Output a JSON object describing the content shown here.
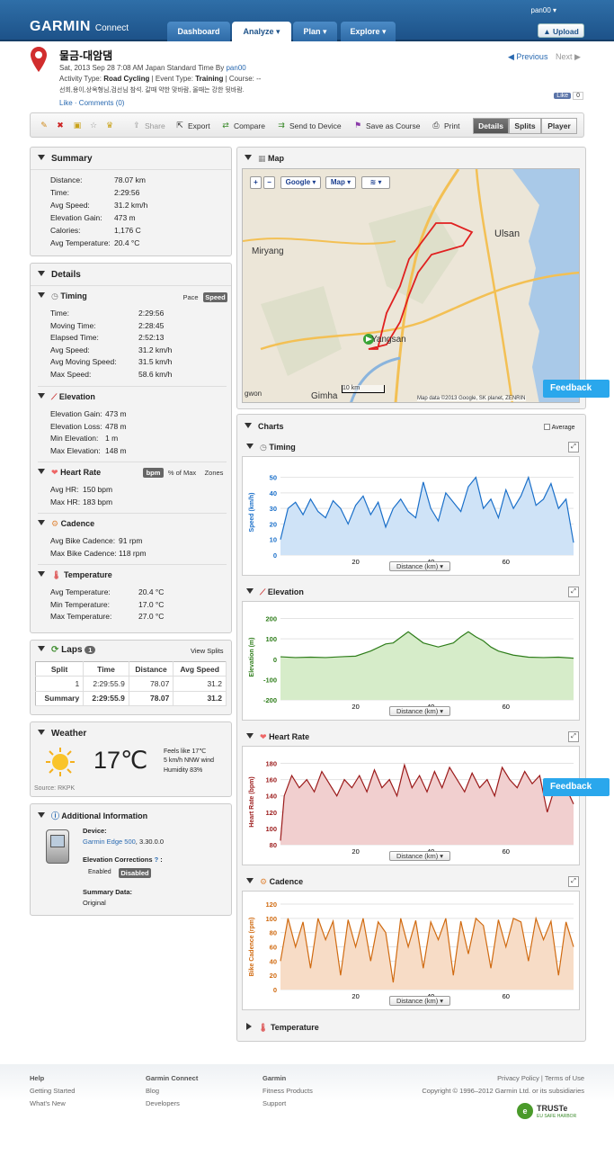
{
  "header": {
    "logo": "GARMIN",
    "logo_sub": "Connect",
    "user": "pan00 ▾",
    "upload": "Upload",
    "nav": [
      "Dashboard",
      "Analyze ▾",
      "Plan ▾",
      "Explore ▾"
    ]
  },
  "activity": {
    "title": "물금-대암댐",
    "date_line": "Sat, 2013 Sep 28 7:08 AM Japan Standard Time By",
    "by": "pan00",
    "type_label": "Activity Type:",
    "type": "Road Cycling",
    "event_label": "| Event Type:",
    "event": "Training",
    "course": "| Course: --",
    "desc": "선회,용이,상옥형님,검선님 참석. 갈때 약한 맞바람, 올때는 강한 뒷바람.",
    "like": "Like",
    "comments": "Comments (0)",
    "prev": "Previous",
    "next": "Next",
    "fb_like": "Like",
    "fb_count": "0"
  },
  "toolbar": {
    "share": "Share",
    "export": "Export",
    "compare": "Compare",
    "send": "Send to Device",
    "save_course": "Save as Course",
    "print": "Print",
    "views": [
      "Details",
      "Splits",
      "Player"
    ]
  },
  "summary": {
    "title": "Summary",
    "rows": [
      [
        "Distance:",
        "78.07 km"
      ],
      [
        "Time:",
        "2:29:56"
      ],
      [
        "Avg Speed:",
        "31.2 km/h"
      ],
      [
        "Elevation Gain:",
        "473 m"
      ],
      [
        "Calories:",
        "1,176 C"
      ],
      [
        "Avg Temperature:",
        "20.4 °C"
      ]
    ]
  },
  "details": {
    "title": "Details",
    "timing": {
      "title": "Timing",
      "pace": "Pace",
      "speed": "Speed",
      "rows": [
        [
          "Time:",
          "2:29:56"
        ],
        [
          "Moving Time:",
          "2:28:45"
        ],
        [
          "Elapsed Time:",
          "2:52:13"
        ],
        [
          "Avg Speed:",
          "31.2 km/h"
        ],
        [
          "Avg Moving Speed:",
          "31.5 km/h"
        ],
        [
          "Max Speed:",
          "58.6 km/h"
        ]
      ]
    },
    "elevation": {
      "title": "Elevation",
      "rows": [
        [
          "Elevation Gain:",
          "473 m"
        ],
        [
          "Elevation Loss:",
          "478 m"
        ],
        [
          "Min Elevation:",
          "1 m"
        ],
        [
          "Max Elevation:",
          "148 m"
        ]
      ]
    },
    "heart": {
      "title": "Heart Rate",
      "bpm": "bpm",
      "pct": "% of Max",
      "zones": "Zones",
      "rows": [
        [
          "Avg HR:",
          "150 bpm"
        ],
        [
          "Max HR:",
          "183 bpm"
        ]
      ]
    },
    "cadence": {
      "title": "Cadence",
      "rows": [
        [
          "Avg Bike Cadence:",
          "91 rpm"
        ],
        [
          "Max Bike Cadence:",
          "118 rpm"
        ]
      ]
    },
    "temperature": {
      "title": "Temperature",
      "rows": [
        [
          "Avg Temperature:",
          "20.4 °C"
        ],
        [
          "Min Temperature:",
          "17.0 °C"
        ],
        [
          "Max Temperature:",
          "27.0 °C"
        ]
      ]
    }
  },
  "laps": {
    "title": "Laps",
    "count": "1",
    "view": "View Splits",
    "headers": [
      "Split",
      "Time",
      "Distance",
      "Avg Speed"
    ],
    "rows": [
      [
        "1",
        "2:29:55.9",
        "78.07",
        "31.2"
      ],
      [
        "Summary",
        "2:29:55.9",
        "78.07",
        "31.2"
      ]
    ]
  },
  "weather": {
    "title": "Weather",
    "temp": "17℃",
    "feels": "Feels like 17℃",
    "wind": "5 km/h NNW wind",
    "humidity": "Humidity 83%",
    "source": "Source: RKPK"
  },
  "additional": {
    "title": "Additional Information",
    "device_label": "Device:",
    "device": "Garmin Edge 500",
    "device_ver": ", 3.30.0.0",
    "elev_label": "Elevation Corrections",
    "enabled": "Enabled",
    "disabled": "Disabled",
    "summary_label": "Summary Data:",
    "summary_val": "Original"
  },
  "map": {
    "title": "Map",
    "google": "Google ▾",
    "maptype": "Map ▾",
    "labels": [
      "Ulsan",
      "Miryang",
      "Yangsan",
      "Gimha",
      "gwon"
    ],
    "scale": "10 km",
    "attribution": "Map data ©2013 Google, SK planet, ZENRIN"
  },
  "charts": {
    "title": "Charts",
    "average": "Average",
    "xsel": "Distance (km) ▾",
    "temperature_title": "Temperature"
  },
  "chart_data": [
    {
      "type": "area",
      "title": "Timing",
      "ylabel": "Speed (km/h)",
      "yticks": [
        0,
        10,
        20,
        30,
        40,
        50
      ],
      "ylim": [
        0,
        55
      ],
      "xticks": [
        20,
        40,
        60
      ],
      "xlim": [
        0,
        78
      ],
      "color": "#1a6fc9",
      "fill": "#cfe3f7",
      "x": [
        0,
        2,
        4,
        6,
        8,
        10,
        12,
        14,
        16,
        18,
        20,
        22,
        24,
        26,
        28,
        30,
        32,
        34,
        36,
        38,
        40,
        42,
        44,
        46,
        48,
        50,
        52,
        54,
        56,
        58,
        60,
        62,
        64,
        66,
        68,
        70,
        72,
        74,
        76,
        78
      ],
      "y": [
        10,
        30,
        34,
        26,
        36,
        28,
        24,
        35,
        30,
        20,
        32,
        38,
        26,
        34,
        18,
        30,
        36,
        28,
        24,
        47,
        30,
        22,
        40,
        34,
        28,
        44,
        50,
        30,
        36,
        24,
        42,
        30,
        38,
        50,
        32,
        36,
        46,
        30,
        36,
        8
      ]
    },
    {
      "type": "area",
      "title": "Elevation",
      "ylabel": "Elevation (m)",
      "yticks": [
        -200,
        -100,
        0,
        100,
        200
      ],
      "ylim": [
        -200,
        220
      ],
      "xticks": [
        20,
        40,
        60
      ],
      "xlim": [
        0,
        78
      ],
      "color": "#2e7d1a",
      "fill": "#d6ecc9",
      "x": [
        0,
        4,
        8,
        12,
        16,
        20,
        24,
        28,
        30,
        34,
        38,
        42,
        46,
        48,
        50,
        52,
        54,
        56,
        58,
        62,
        66,
        70,
        74,
        78
      ],
      "y": [
        12,
        8,
        10,
        8,
        12,
        15,
        40,
        75,
        80,
        135,
        80,
        60,
        80,
        110,
        135,
        110,
        90,
        60,
        40,
        20,
        10,
        8,
        10,
        5
      ]
    },
    {
      "type": "area",
      "title": "Heart Rate",
      "ylabel": "Heart Rate (bpm)",
      "yticks": [
        80,
        100,
        120,
        140,
        160,
        180
      ],
      "ylim": [
        80,
        185
      ],
      "xticks": [
        20,
        40,
        60
      ],
      "xlim": [
        0,
        78
      ],
      "color": "#9b1a1a",
      "fill": "#f1cfcf",
      "x": [
        0,
        1,
        3,
        5,
        7,
        9,
        11,
        13,
        15,
        17,
        19,
        21,
        23,
        25,
        27,
        29,
        31,
        33,
        35,
        37,
        39,
        41,
        43,
        45,
        47,
        49,
        51,
        53,
        55,
        57,
        59,
        61,
        63,
        65,
        67,
        69,
        71,
        73,
        75,
        77,
        78
      ],
      "y": [
        85,
        140,
        165,
        150,
        160,
        145,
        170,
        155,
        140,
        160,
        150,
        165,
        145,
        172,
        150,
        160,
        140,
        178,
        150,
        165,
        145,
        170,
        150,
        175,
        160,
        145,
        168,
        150,
        160,
        140,
        175,
        160,
        150,
        170,
        155,
        165,
        120,
        150,
        160,
        140,
        130
      ]
    },
    {
      "type": "area",
      "title": "Cadence",
      "ylabel": "Bike Cadence (rpm)",
      "yticks": [
        0,
        20,
        40,
        60,
        80,
        100,
        120
      ],
      "ylim": [
        0,
        120
      ],
      "xticks": [
        20,
        40,
        60
      ],
      "xlim": [
        0,
        78
      ],
      "color": "#d06a10",
      "fill": "#f7dcc6",
      "x": [
        0,
        2,
        4,
        6,
        8,
        10,
        12,
        14,
        16,
        18,
        20,
        22,
        24,
        26,
        28,
        30,
        32,
        34,
        36,
        38,
        40,
        42,
        44,
        46,
        48,
        50,
        52,
        54,
        56,
        58,
        60,
        62,
        64,
        66,
        68,
        70,
        72,
        74,
        76,
        78
      ],
      "y": [
        40,
        100,
        60,
        95,
        30,
        100,
        70,
        96,
        20,
        98,
        60,
        100,
        40,
        95,
        80,
        10,
        100,
        60,
        97,
        30,
        95,
        70,
        100,
        20,
        96,
        50,
        100,
        90,
        30,
        98,
        60,
        100,
        95,
        40,
        100,
        70,
        96,
        20,
        95,
        60
      ]
    }
  ],
  "footer": {
    "help": "Help",
    "getting": "Getting Started",
    "whatsnew": "What's New",
    "gc": "Garmin Connect",
    "blog": "Blog",
    "dev": "Developers",
    "garmin": "Garmin",
    "fitness": "Fitness Products",
    "support": "Support",
    "privacy": "Privacy Policy | Terms of Use",
    "copyright": "Copyright © 1996–2012 Garmin Ltd. or its subsidiaries",
    "truste": "TRUSTe",
    "truste_sub": "EU SAFE HARBOR"
  },
  "feedback": "Feedback"
}
